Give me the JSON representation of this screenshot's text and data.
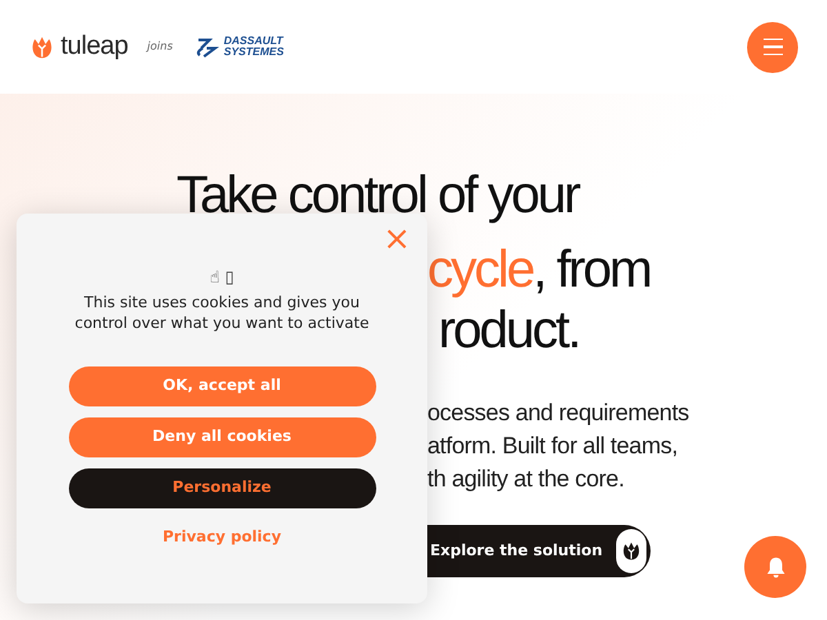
{
  "header": {
    "logo": "tuleap",
    "joins": "joins",
    "partner_logo": [
      "DASSAULT",
      "SYSTEMES"
    ]
  },
  "hero": {
    "title_line_1": "Take control of your",
    "title_line_2": [
      {
        "text": "cycle",
        "accent": true
      },
      {
        "text": ", from",
        "accent": false
      }
    ],
    "title_line_3": "roduct.",
    "description_lines": [
      "ocesses and requirements",
      "atform. Built for all teams,",
      "th agility at the core."
    ],
    "cta": "Explore the solution"
  },
  "cookie_dialog": {
    "close": "×",
    "emoji": "☝ ▯",
    "message_lines": [
      "This site uses cookies and gives you",
      "control over what you want to activate"
    ],
    "buttons": [
      {
        "label": "OK, accept all",
        "kind": "primary"
      },
      {
        "label": "Deny all cookies",
        "kind": "primary"
      },
      {
        "label": "Personalize",
        "kind": "dark"
      }
    ],
    "link": "Privacy policy"
  }
}
